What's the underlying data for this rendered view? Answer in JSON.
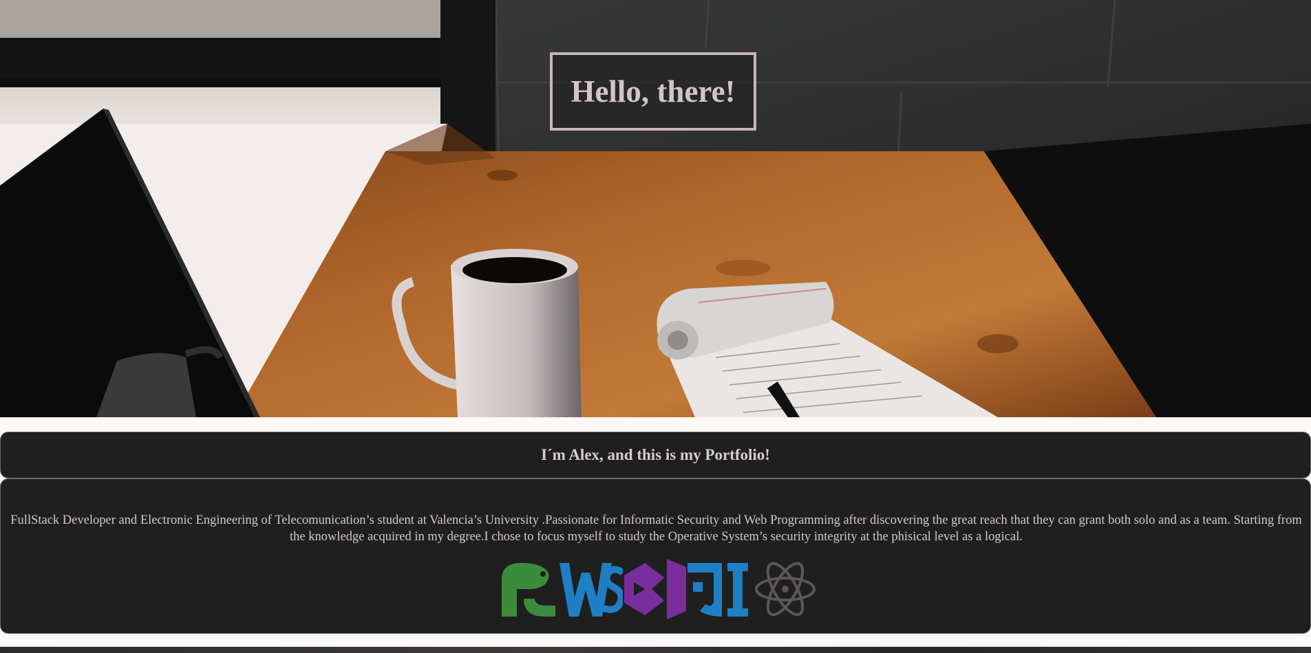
{
  "hero": {
    "title": "Hello, there!"
  },
  "intro": {
    "heading": "I´m Alex, and this is my Portfolio!",
    "description": "FullStack Developer and Electronic Engineering of Telecomunication’s student at Valencia’s University .Passionate for Informatic Security and Web Programming after discovering the great reach that they can grant both solo and as a team. Starting from the knowledge acquired in my degree.I chose to focus myself to study the Operative System’s security integrity at the phisical level as a logical."
  },
  "tools": [
    {
      "name": "pycharm",
      "color": "#3c8a3c"
    },
    {
      "name": "webstorm",
      "color": "#1f7fc4"
    },
    {
      "name": "visual-studio",
      "color": "#7a2d9c"
    },
    {
      "name": "intellij",
      "color": "#1f7fc4"
    },
    {
      "name": "atom",
      "color": "#5c5658"
    }
  ],
  "colors": {
    "panel": "#1f1f1f",
    "hero_title": "#d3c4c6",
    "text": "#d6c8c9",
    "page_background": "#fdf7f5"
  }
}
